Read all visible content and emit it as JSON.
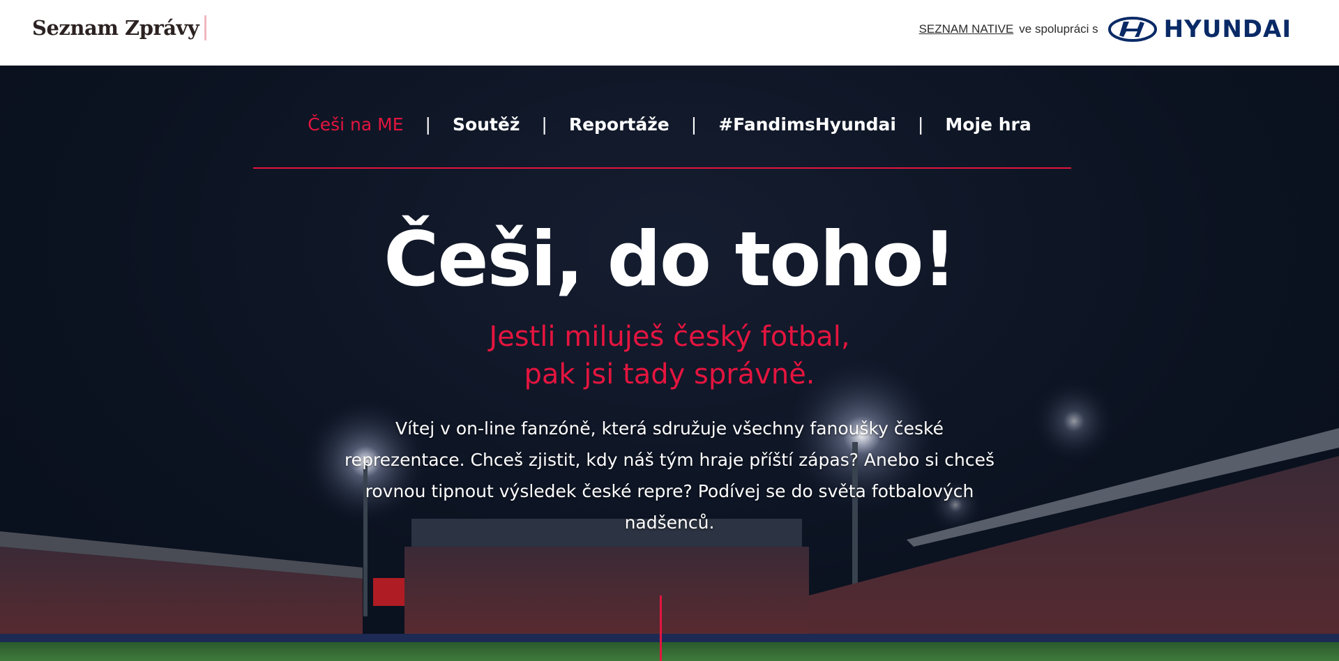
{
  "header": {
    "logo": "Seznam Zprávy",
    "partner_link": "SEZNAM NATIVE",
    "partner_text": "ve spolupráci s",
    "brand": "HYUNDAI"
  },
  "nav": {
    "items": [
      {
        "label": "Češi na ME",
        "active": true
      },
      {
        "label": "Soutěž",
        "active": false
      },
      {
        "label": "Reportáže",
        "active": false
      },
      {
        "label": "#FandimsHyundai",
        "active": false
      },
      {
        "label": "Moje hra",
        "active": false
      }
    ],
    "separator": "|"
  },
  "hero": {
    "title": "Češi, do toho!",
    "subtitle_line1": "Jestli miluješ český fotbal,",
    "subtitle_line2": "pak jsi tady správně.",
    "intro": "Vítej v on-line fanzóně, která sdružuje všechny fanoušky české reprezentace. Chceš zjistit, kdy náš tým hraje příští zápas? Anebo si chceš rovnou tipnout výsledek české repre? Podívej se do světa fotbalových nadšenců."
  },
  "colors": {
    "accent": "#e4153f",
    "background": "#0e1626",
    "brand_blue": "#0a2a66"
  },
  "icons": {
    "brand_logo": "hyundai-logo-icon"
  }
}
